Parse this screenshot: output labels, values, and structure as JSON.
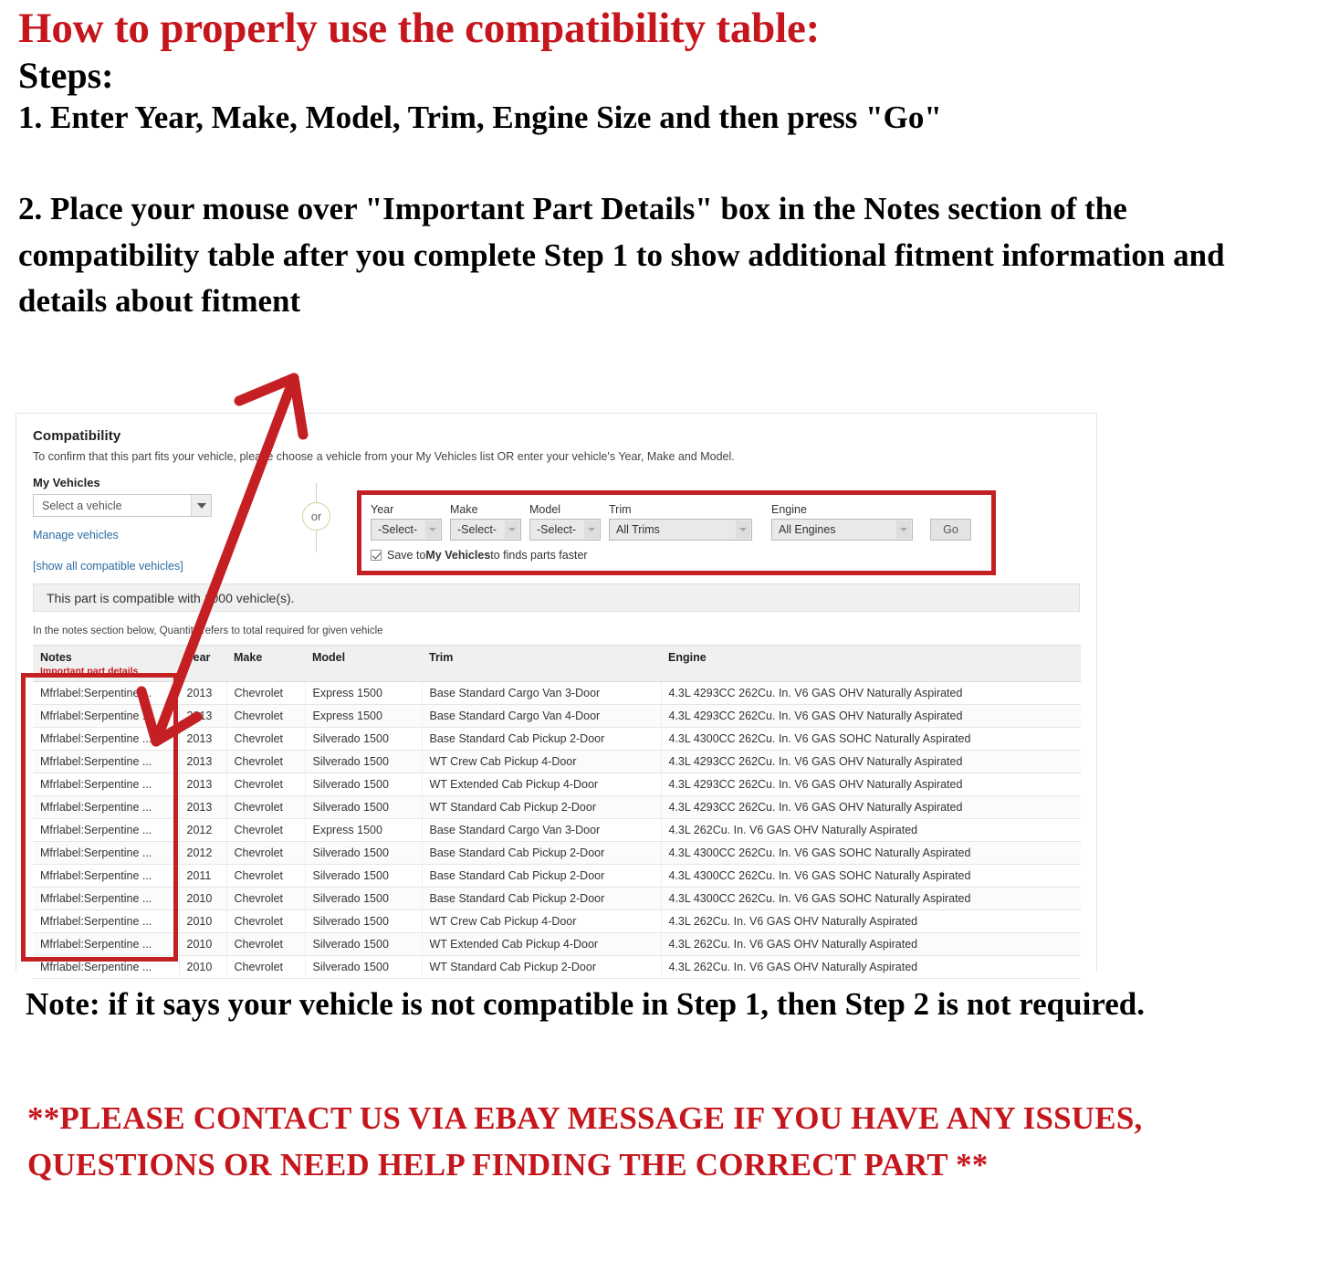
{
  "instructions": {
    "headline": "How to properly use the compatibility table:",
    "steps_label": "Steps:",
    "step1": "1. Enter Year, Make, Model, Trim, Engine Size and then press \"Go\"",
    "step2": "2. Place your mouse over \"Important Part Details\" box in the Notes section of the compatibility table after you complete Step 1 to show additional fitment information and details about fitment"
  },
  "compatibility": {
    "title": "Compatibility",
    "subtitle": "To confirm that this part fits your vehicle, please choose a vehicle from your My Vehicles list OR enter your vehicle's Year, Make and Model.",
    "my_vehicles_label": "My Vehicles",
    "vehicle_select_value": "Select a vehicle",
    "manage_vehicles_link": "Manage vehicles",
    "show_all_link": "[show all compatible vehicles]",
    "or_label": "or",
    "finder": {
      "year_label": "Year",
      "year_value": "-Select-",
      "make_label": "Make",
      "make_value": "-Select-",
      "model_label": "Model",
      "model_value": "-Select-",
      "trim_label": "Trim",
      "trim_value": "All Trims",
      "engine_label": "Engine",
      "engine_value": "All Engines",
      "go_label": "Go",
      "save_prefix": "Save to ",
      "save_bold": "My Vehicles",
      "save_suffix": " to finds parts faster"
    },
    "banner": "This part is compatible with 1000 vehicle(s).",
    "qty_note": "In the notes section below, Quantity refers to total required for given vehicle",
    "table": {
      "headers": {
        "notes": "Notes",
        "notes_sub": "Important part details",
        "year": "Year",
        "make": "Make",
        "model": "Model",
        "trim": "Trim",
        "engine": "Engine"
      },
      "rows": [
        {
          "notes": "Mfrlabel:Serpentine ...",
          "year": "2013",
          "make": "Chevrolet",
          "model": "Express 1500",
          "trim": "Base Standard Cargo Van 3-Door",
          "engine": "4.3L 4293CC 262Cu. In. V6 GAS OHV Naturally Aspirated"
        },
        {
          "notes": "Mfrlabel:Serpentine ...",
          "year": "2013",
          "make": "Chevrolet",
          "model": "Express 1500",
          "trim": "Base Standard Cargo Van 4-Door",
          "engine": "4.3L 4293CC 262Cu. In. V6 GAS OHV Naturally Aspirated"
        },
        {
          "notes": "Mfrlabel:Serpentine ...",
          "year": "2013",
          "make": "Chevrolet",
          "model": "Silverado 1500",
          "trim": "Base Standard Cab Pickup 2-Door",
          "engine": "4.3L 4300CC 262Cu. In. V6 GAS SOHC Naturally Aspirated"
        },
        {
          "notes": "Mfrlabel:Serpentine ...",
          "year": "2013",
          "make": "Chevrolet",
          "model": "Silverado 1500",
          "trim": "WT Crew Cab Pickup 4-Door",
          "engine": "4.3L 4293CC 262Cu. In. V6 GAS OHV Naturally Aspirated"
        },
        {
          "notes": "Mfrlabel:Serpentine ...",
          "year": "2013",
          "make": "Chevrolet",
          "model": "Silverado 1500",
          "trim": "WT Extended Cab Pickup 4-Door",
          "engine": "4.3L 4293CC 262Cu. In. V6 GAS OHV Naturally Aspirated"
        },
        {
          "notes": "Mfrlabel:Serpentine ...",
          "year": "2013",
          "make": "Chevrolet",
          "model": "Silverado 1500",
          "trim": "WT Standard Cab Pickup 2-Door",
          "engine": "4.3L 4293CC 262Cu. In. V6 GAS OHV Naturally Aspirated"
        },
        {
          "notes": "Mfrlabel:Serpentine ...",
          "year": "2012",
          "make": "Chevrolet",
          "model": "Express 1500",
          "trim": "Base Standard Cargo Van 3-Door",
          "engine": "4.3L 262Cu. In. V6 GAS OHV Naturally Aspirated"
        },
        {
          "notes": "Mfrlabel:Serpentine ...",
          "year": "2012",
          "make": "Chevrolet",
          "model": "Silverado 1500",
          "trim": "Base Standard Cab Pickup 2-Door",
          "engine": "4.3L 4300CC 262Cu. In. V6 GAS SOHC Naturally Aspirated"
        },
        {
          "notes": "Mfrlabel:Serpentine ...",
          "year": "2011",
          "make": "Chevrolet",
          "model": "Silverado 1500",
          "trim": "Base Standard Cab Pickup 2-Door",
          "engine": "4.3L 4300CC 262Cu. In. V6 GAS SOHC Naturally Aspirated"
        },
        {
          "notes": "Mfrlabel:Serpentine ...",
          "year": "2010",
          "make": "Chevrolet",
          "model": "Silverado 1500",
          "trim": "Base Standard Cab Pickup 2-Door",
          "engine": "4.3L 4300CC 262Cu. In. V6 GAS SOHC Naturally Aspirated"
        },
        {
          "notes": "Mfrlabel:Serpentine ...",
          "year": "2010",
          "make": "Chevrolet",
          "model": "Silverado 1500",
          "trim": "WT Crew Cab Pickup 4-Door",
          "engine": "4.3L 262Cu. In. V6 GAS OHV Naturally Aspirated"
        },
        {
          "notes": "Mfrlabel:Serpentine ...",
          "year": "2010",
          "make": "Chevrolet",
          "model": "Silverado 1500",
          "trim": "WT Extended Cab Pickup 4-Door",
          "engine": "4.3L 262Cu. In. V6 GAS OHV Naturally Aspirated"
        },
        {
          "notes": "Mfrlabel:Serpentine ...",
          "year": "2010",
          "make": "Chevrolet",
          "model": "Silverado 1500",
          "trim": "WT Standard Cab Pickup 2-Door",
          "engine": "4.3L 262Cu. In. V6 GAS OHV Naturally Aspirated"
        }
      ]
    }
  },
  "footer": {
    "note": "Note: if it says your vehicle is not compatible in Step 1, then Step 2 is not required.",
    "contact": "**PLEASE CONTACT US VIA EBAY MESSAGE IF YOU HAVE ANY ISSUES, QUESTIONS OR NEED HELP FINDING THE CORRECT PART **"
  },
  "colors": {
    "accent_red": "#c4161c",
    "box_red": "#c42024",
    "link_blue": "#2b6ca3"
  }
}
